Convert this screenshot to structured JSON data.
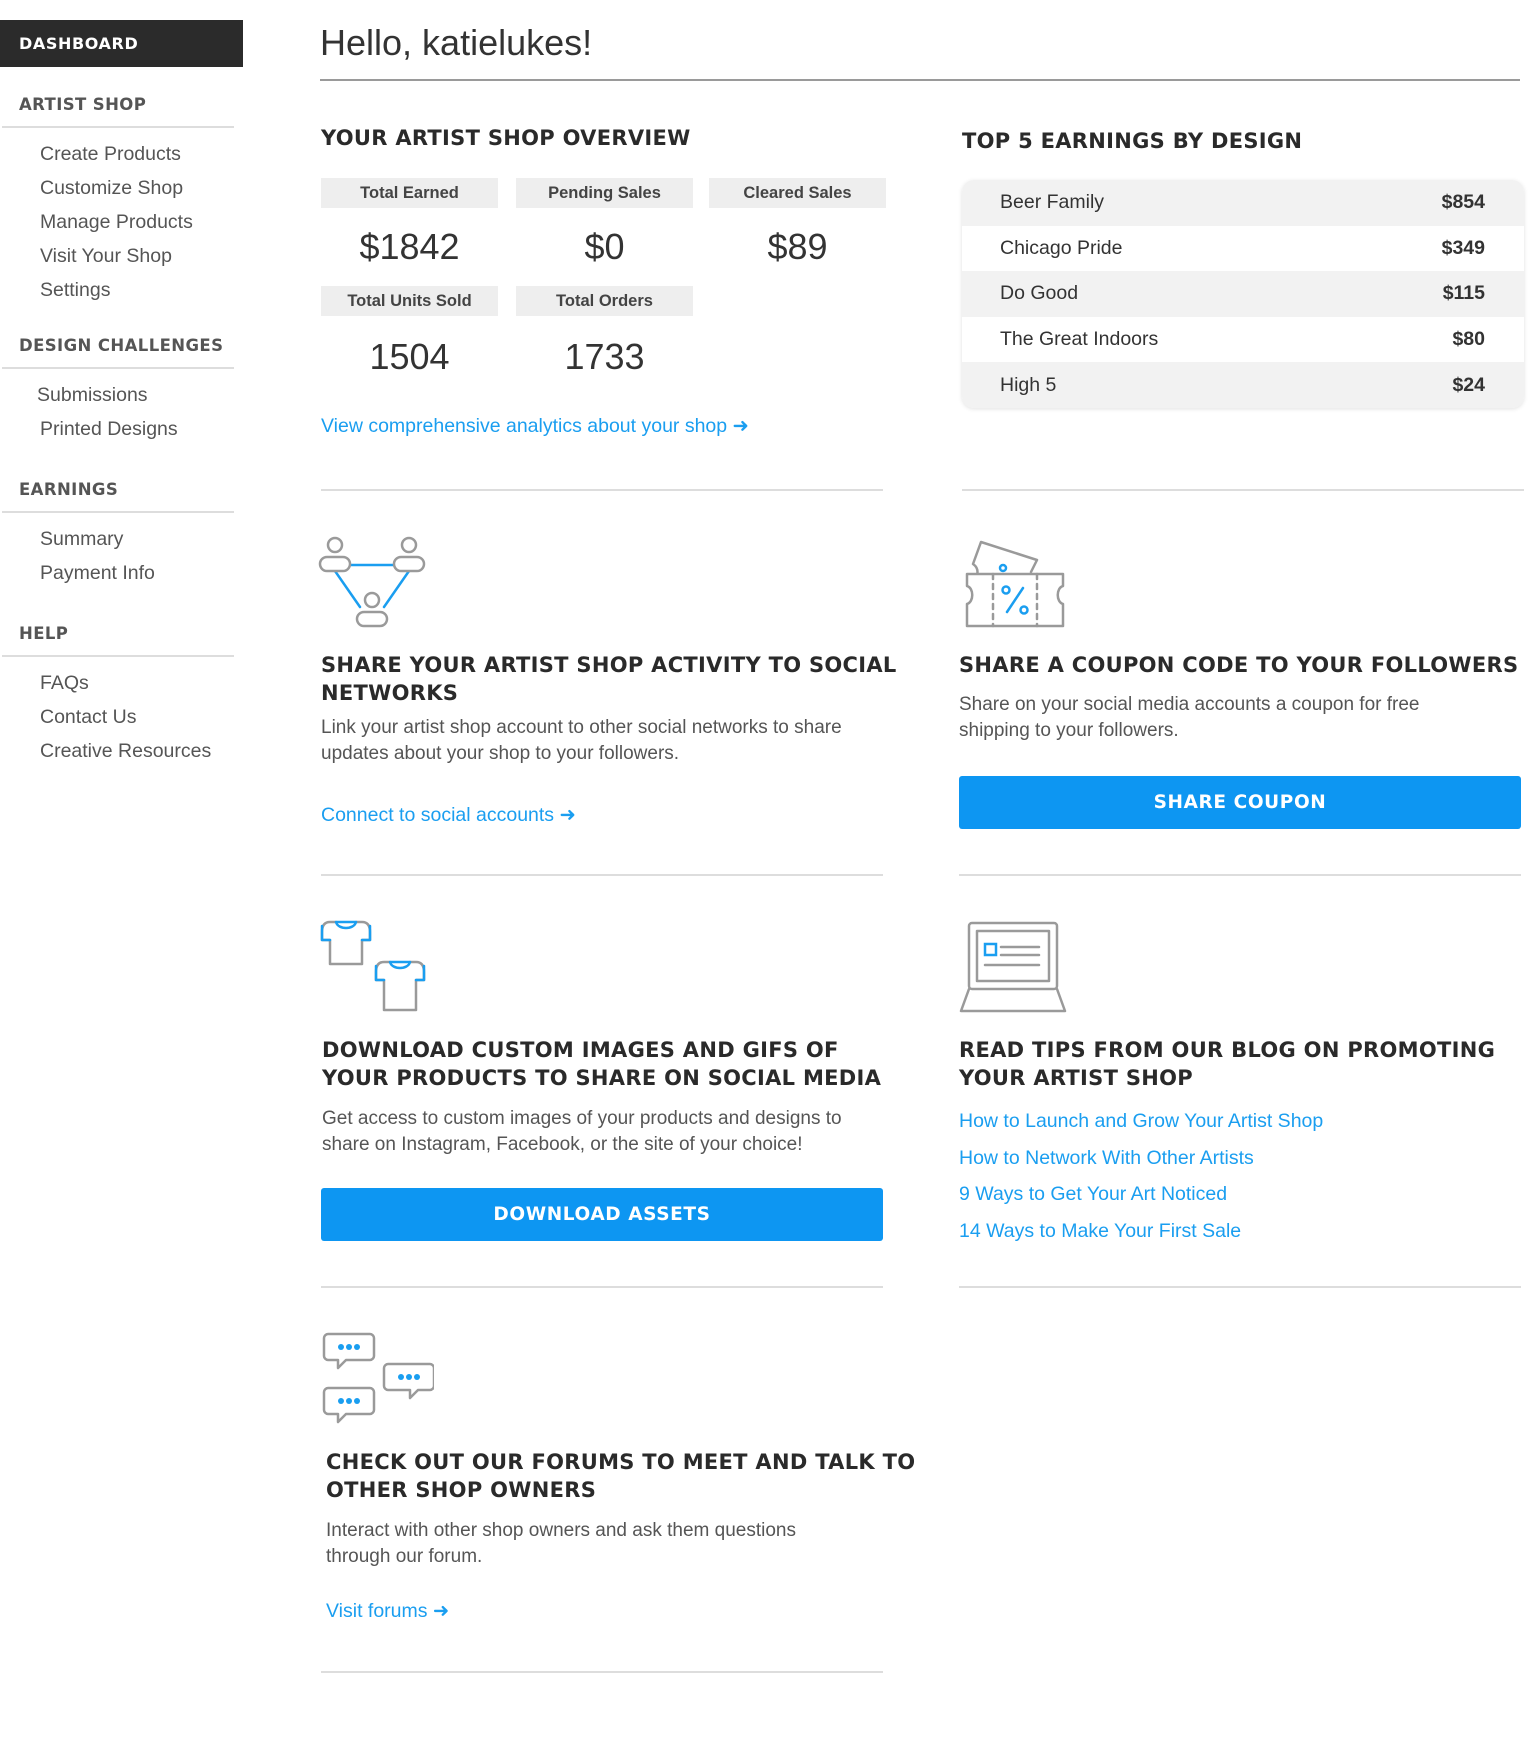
{
  "sidebar": {
    "dashboard": "DASHBOARD",
    "sections": [
      {
        "title": "ARTIST SHOP",
        "items": [
          "Create Products",
          "Customize Shop",
          "Manage Products",
          "Visit Your Shop",
          "Settings"
        ]
      },
      {
        "title": "DESIGN CHALLENGES",
        "items": [
          "Submissions",
          "Printed Designs"
        ]
      },
      {
        "title": "EARNINGS",
        "items": [
          "Summary",
          "Payment Info"
        ]
      },
      {
        "title": "HELP",
        "items": [
          "FAQs",
          "Contact Us",
          "Creative Resources"
        ]
      }
    ]
  },
  "greeting": "Hello, katielukes!",
  "overview": {
    "title": "YOUR ARTIST SHOP OVERVIEW",
    "stats": [
      {
        "label": "Total Earned",
        "value": "$1842"
      },
      {
        "label": "Pending Sales",
        "value": "$0"
      },
      {
        "label": "Cleared Sales",
        "value": "$89"
      },
      {
        "label": "Total Units Sold",
        "value": "1504"
      },
      {
        "label": "Total Orders",
        "value": "1733"
      }
    ],
    "analytics_link": "View comprehensive analytics about your shop ➜"
  },
  "top_earnings": {
    "title": "TOP 5 EARNINGS BY DESIGN",
    "rows": [
      {
        "name": "Beer Family",
        "amount": "$854"
      },
      {
        "name": "Chicago Pride",
        "amount": "$349"
      },
      {
        "name": "Do Good",
        "amount": "$115"
      },
      {
        "name": "The Great Indoors",
        "amount": "$80"
      },
      {
        "name": "High 5",
        "amount": "$24"
      }
    ]
  },
  "social": {
    "title_line1": "SHARE YOUR ARTIST SHOP ACTIVITY TO SOCIAL",
    "title_line2": "NETWORKS",
    "text_line1": "Link your artist shop account to other social networks to share",
    "text_line2": "updates about your shop to your followers.",
    "link": "Connect to social accounts ➜"
  },
  "coupon": {
    "title": "SHARE A COUPON CODE TO YOUR FOLLOWERS",
    "text_line1": "Share on your social media accounts a coupon for free",
    "text_line2": "shipping to your followers.",
    "button": "SHARE COUPON"
  },
  "assets": {
    "title_line1": "DOWNLOAD CUSTOM IMAGES AND GIFS OF",
    "title_line2": "YOUR PRODUCTS TO SHARE ON SOCIAL MEDIA",
    "text_line1": "Get access to custom images of your products and designs to",
    "text_line2": "share on Instagram, Facebook, or the site of your choice!",
    "button": "DOWNLOAD ASSETS"
  },
  "blog": {
    "title_line1": "READ TIPS FROM OUR BLOG ON PROMOTING",
    "title_line2": "YOUR ARTIST SHOP",
    "links": [
      "How to Launch and Grow Your Artist Shop",
      "How to Network With Other Artists",
      "9 Ways to Get Your Art Noticed",
      "14 Ways to Make Your First Sale"
    ]
  },
  "forums": {
    "title_line1": "CHECK OUT OUR FORUMS TO MEET AND TALK TO",
    "title_line2": "OTHER SHOP OWNERS",
    "text_line1": "Interact with other shop owners and ask them questions",
    "text_line2": "through our forum.",
    "link": "Visit forums ➜"
  },
  "colors": {
    "accent": "#0d96f2",
    "link": "#1a9ef0",
    "dashboard_bg": "#2b2b2b",
    "icon_gray": "#9a9a9a"
  },
  "icons": [
    "people-network-icon",
    "coupon-ticket-icon",
    "tshirt-icon",
    "laptop-blog-icon",
    "chat-bubbles-icon"
  ]
}
